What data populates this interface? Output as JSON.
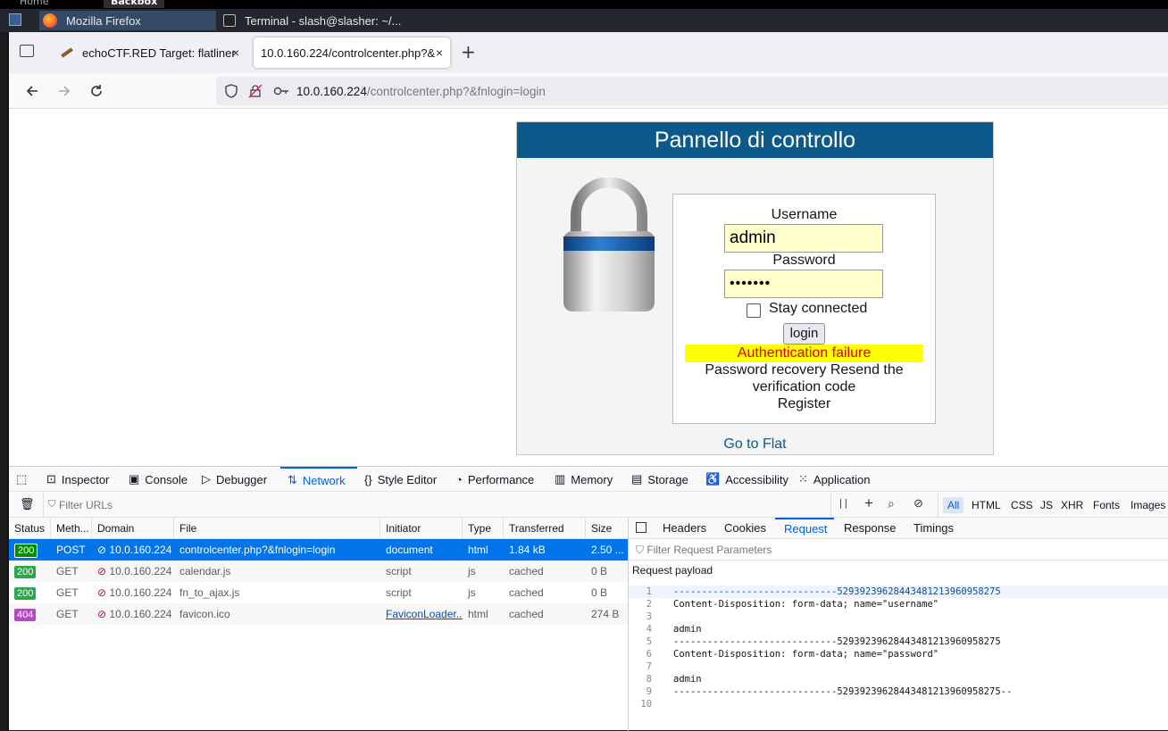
{
  "os": {
    "tabs": [
      "Home",
      "Backbox"
    ]
  },
  "taskbar": {
    "items": [
      {
        "label": "Mozilla Firefox",
        "icon": "firefox-icon"
      },
      {
        "label": "Terminal - slash@slasher: ~/...",
        "icon": "terminal-icon"
      }
    ]
  },
  "browser": {
    "tabs": [
      {
        "label": "echoCTF.RED Target: flatliner",
        "close": "×"
      },
      {
        "label": "10.0.160.224/controlcenter.php?&",
        "close": "×"
      }
    ],
    "new_tab": "+",
    "url_host": "10.0.160.224",
    "url_path": "/controlcenter.php?&fnlogin=login"
  },
  "page": {
    "title": "Pannello di controllo",
    "username_label": "Username",
    "username_value": "admin",
    "password_label": "Password",
    "password_value": "•••••••",
    "stay_connected": "Stay connected",
    "login_button": "login",
    "error": "Authentication failure",
    "recovery_line1": "Password recovery Resend the",
    "recovery_line2": "verification code",
    "register": "Register",
    "goto_flat": "Go to Flat"
  },
  "devtools": {
    "tabs": [
      "Inspector",
      "Console",
      "Debugger",
      "Network",
      "Style Editor",
      "Performance",
      "Memory",
      "Storage",
      "Accessibility",
      "Application"
    ],
    "filter_placeholder": "Filter URLs",
    "pause_label": "| |",
    "type_filters": [
      "All",
      "HTML",
      "CSS",
      "JS",
      "XHR",
      "Fonts",
      "Images"
    ],
    "columns": [
      "Status",
      "Meth...",
      "Domain",
      "File",
      "Initiator",
      "Type",
      "Transferred",
      "Size"
    ],
    "rows": [
      {
        "status": "200",
        "method": "POST",
        "domain": "10.0.160.224",
        "file": "controlcenter.php?&fnlogin=login",
        "initiator": "document",
        "type": "html",
        "transferred": "1.84 kB",
        "size": "2.50 ..."
      },
      {
        "status": "200",
        "method": "GET",
        "domain": "10.0.160.224",
        "file": "calendar.js",
        "initiator": "script",
        "type": "js",
        "transferred": "cached",
        "size": "0 B"
      },
      {
        "status": "200",
        "method": "GET",
        "domain": "10.0.160.224",
        "file": "fn_to_ajax.js",
        "initiator": "script",
        "type": "js",
        "transferred": "cached",
        "size": "0 B"
      },
      {
        "status": "404",
        "method": "GET",
        "domain": "10.0.160.224",
        "file": "favicon.ico",
        "initiator": "FaviconLoader...",
        "type": "html",
        "transferred": "cached",
        "size": "274 B"
      }
    ],
    "side_tabs": [
      "Headers",
      "Cookies",
      "Request",
      "Response",
      "Timings"
    ],
    "side_filter": "Filter Request Parameters",
    "payload_title": "Request payload",
    "payload_lines": [
      "-----------------------------52939239628443481213960958275",
      "Content-Disposition: form-data; name=\"username\"",
      "",
      "admin",
      "-----------------------------52939239628443481213960958275",
      "Content-Disposition: form-data; name=\"password\"",
      "",
      "admin",
      "-----------------------------52939239628443481213960958275--",
      ""
    ],
    "line_numbers": [
      "1",
      "2",
      "3",
      "4",
      "5",
      "6",
      "7",
      "8",
      "9",
      "10"
    ]
  }
}
